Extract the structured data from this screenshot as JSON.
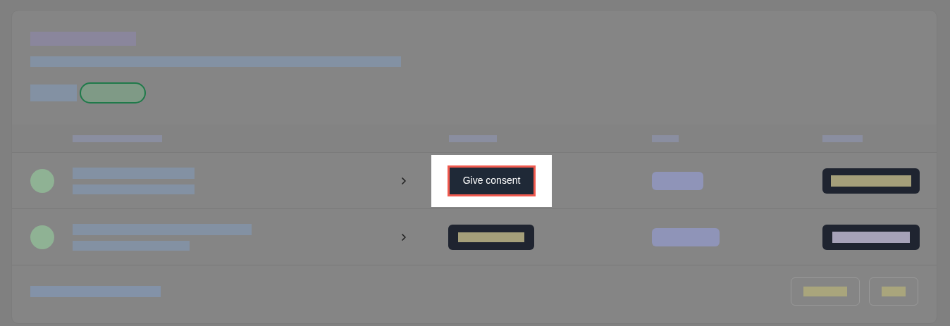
{
  "rows": [
    {
      "action": {
        "label": "Give consent",
        "highlighted": true
      }
    },
    {
      "action": {
        "highlighted": false
      }
    }
  ]
}
